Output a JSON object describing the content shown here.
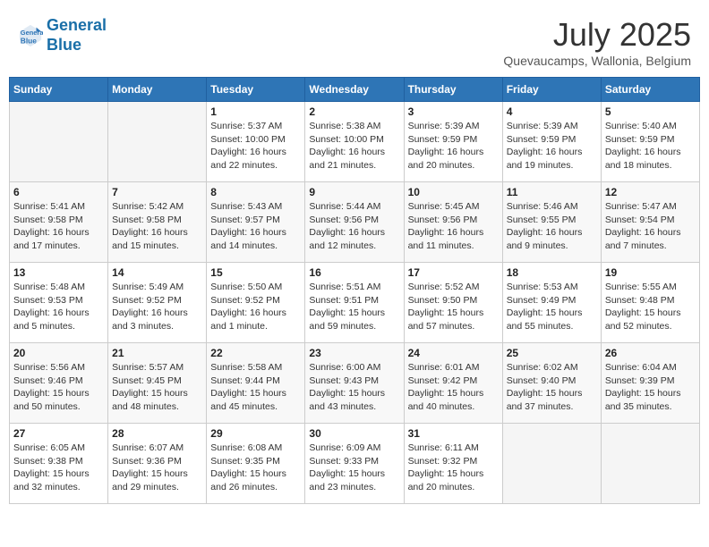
{
  "header": {
    "logo_line1": "General",
    "logo_line2": "Blue",
    "month": "July 2025",
    "location": "Quevaucamps, Wallonia, Belgium"
  },
  "weekdays": [
    "Sunday",
    "Monday",
    "Tuesday",
    "Wednesday",
    "Thursday",
    "Friday",
    "Saturday"
  ],
  "weeks": [
    [
      {
        "day": "",
        "info": ""
      },
      {
        "day": "",
        "info": ""
      },
      {
        "day": "1",
        "info": "Sunrise: 5:37 AM\nSunset: 10:00 PM\nDaylight: 16 hours\nand 22 minutes."
      },
      {
        "day": "2",
        "info": "Sunrise: 5:38 AM\nSunset: 10:00 PM\nDaylight: 16 hours\nand 21 minutes."
      },
      {
        "day": "3",
        "info": "Sunrise: 5:39 AM\nSunset: 9:59 PM\nDaylight: 16 hours\nand 20 minutes."
      },
      {
        "day": "4",
        "info": "Sunrise: 5:39 AM\nSunset: 9:59 PM\nDaylight: 16 hours\nand 19 minutes."
      },
      {
        "day": "5",
        "info": "Sunrise: 5:40 AM\nSunset: 9:59 PM\nDaylight: 16 hours\nand 18 minutes."
      }
    ],
    [
      {
        "day": "6",
        "info": "Sunrise: 5:41 AM\nSunset: 9:58 PM\nDaylight: 16 hours\nand 17 minutes."
      },
      {
        "day": "7",
        "info": "Sunrise: 5:42 AM\nSunset: 9:58 PM\nDaylight: 16 hours\nand 15 minutes."
      },
      {
        "day": "8",
        "info": "Sunrise: 5:43 AM\nSunset: 9:57 PM\nDaylight: 16 hours\nand 14 minutes."
      },
      {
        "day": "9",
        "info": "Sunrise: 5:44 AM\nSunset: 9:56 PM\nDaylight: 16 hours\nand 12 minutes."
      },
      {
        "day": "10",
        "info": "Sunrise: 5:45 AM\nSunset: 9:56 PM\nDaylight: 16 hours\nand 11 minutes."
      },
      {
        "day": "11",
        "info": "Sunrise: 5:46 AM\nSunset: 9:55 PM\nDaylight: 16 hours\nand 9 minutes."
      },
      {
        "day": "12",
        "info": "Sunrise: 5:47 AM\nSunset: 9:54 PM\nDaylight: 16 hours\nand 7 minutes."
      }
    ],
    [
      {
        "day": "13",
        "info": "Sunrise: 5:48 AM\nSunset: 9:53 PM\nDaylight: 16 hours\nand 5 minutes."
      },
      {
        "day": "14",
        "info": "Sunrise: 5:49 AM\nSunset: 9:52 PM\nDaylight: 16 hours\nand 3 minutes."
      },
      {
        "day": "15",
        "info": "Sunrise: 5:50 AM\nSunset: 9:52 PM\nDaylight: 16 hours\nand 1 minute."
      },
      {
        "day": "16",
        "info": "Sunrise: 5:51 AM\nSunset: 9:51 PM\nDaylight: 15 hours\nand 59 minutes."
      },
      {
        "day": "17",
        "info": "Sunrise: 5:52 AM\nSunset: 9:50 PM\nDaylight: 15 hours\nand 57 minutes."
      },
      {
        "day": "18",
        "info": "Sunrise: 5:53 AM\nSunset: 9:49 PM\nDaylight: 15 hours\nand 55 minutes."
      },
      {
        "day": "19",
        "info": "Sunrise: 5:55 AM\nSunset: 9:48 PM\nDaylight: 15 hours\nand 52 minutes."
      }
    ],
    [
      {
        "day": "20",
        "info": "Sunrise: 5:56 AM\nSunset: 9:46 PM\nDaylight: 15 hours\nand 50 minutes."
      },
      {
        "day": "21",
        "info": "Sunrise: 5:57 AM\nSunset: 9:45 PM\nDaylight: 15 hours\nand 48 minutes."
      },
      {
        "day": "22",
        "info": "Sunrise: 5:58 AM\nSunset: 9:44 PM\nDaylight: 15 hours\nand 45 minutes."
      },
      {
        "day": "23",
        "info": "Sunrise: 6:00 AM\nSunset: 9:43 PM\nDaylight: 15 hours\nand 43 minutes."
      },
      {
        "day": "24",
        "info": "Sunrise: 6:01 AM\nSunset: 9:42 PM\nDaylight: 15 hours\nand 40 minutes."
      },
      {
        "day": "25",
        "info": "Sunrise: 6:02 AM\nSunset: 9:40 PM\nDaylight: 15 hours\nand 37 minutes."
      },
      {
        "day": "26",
        "info": "Sunrise: 6:04 AM\nSunset: 9:39 PM\nDaylight: 15 hours\nand 35 minutes."
      }
    ],
    [
      {
        "day": "27",
        "info": "Sunrise: 6:05 AM\nSunset: 9:38 PM\nDaylight: 15 hours\nand 32 minutes."
      },
      {
        "day": "28",
        "info": "Sunrise: 6:07 AM\nSunset: 9:36 PM\nDaylight: 15 hours\nand 29 minutes."
      },
      {
        "day": "29",
        "info": "Sunrise: 6:08 AM\nSunset: 9:35 PM\nDaylight: 15 hours\nand 26 minutes."
      },
      {
        "day": "30",
        "info": "Sunrise: 6:09 AM\nSunset: 9:33 PM\nDaylight: 15 hours\nand 23 minutes."
      },
      {
        "day": "31",
        "info": "Sunrise: 6:11 AM\nSunset: 9:32 PM\nDaylight: 15 hours\nand 20 minutes."
      },
      {
        "day": "",
        "info": ""
      },
      {
        "day": "",
        "info": ""
      }
    ]
  ]
}
